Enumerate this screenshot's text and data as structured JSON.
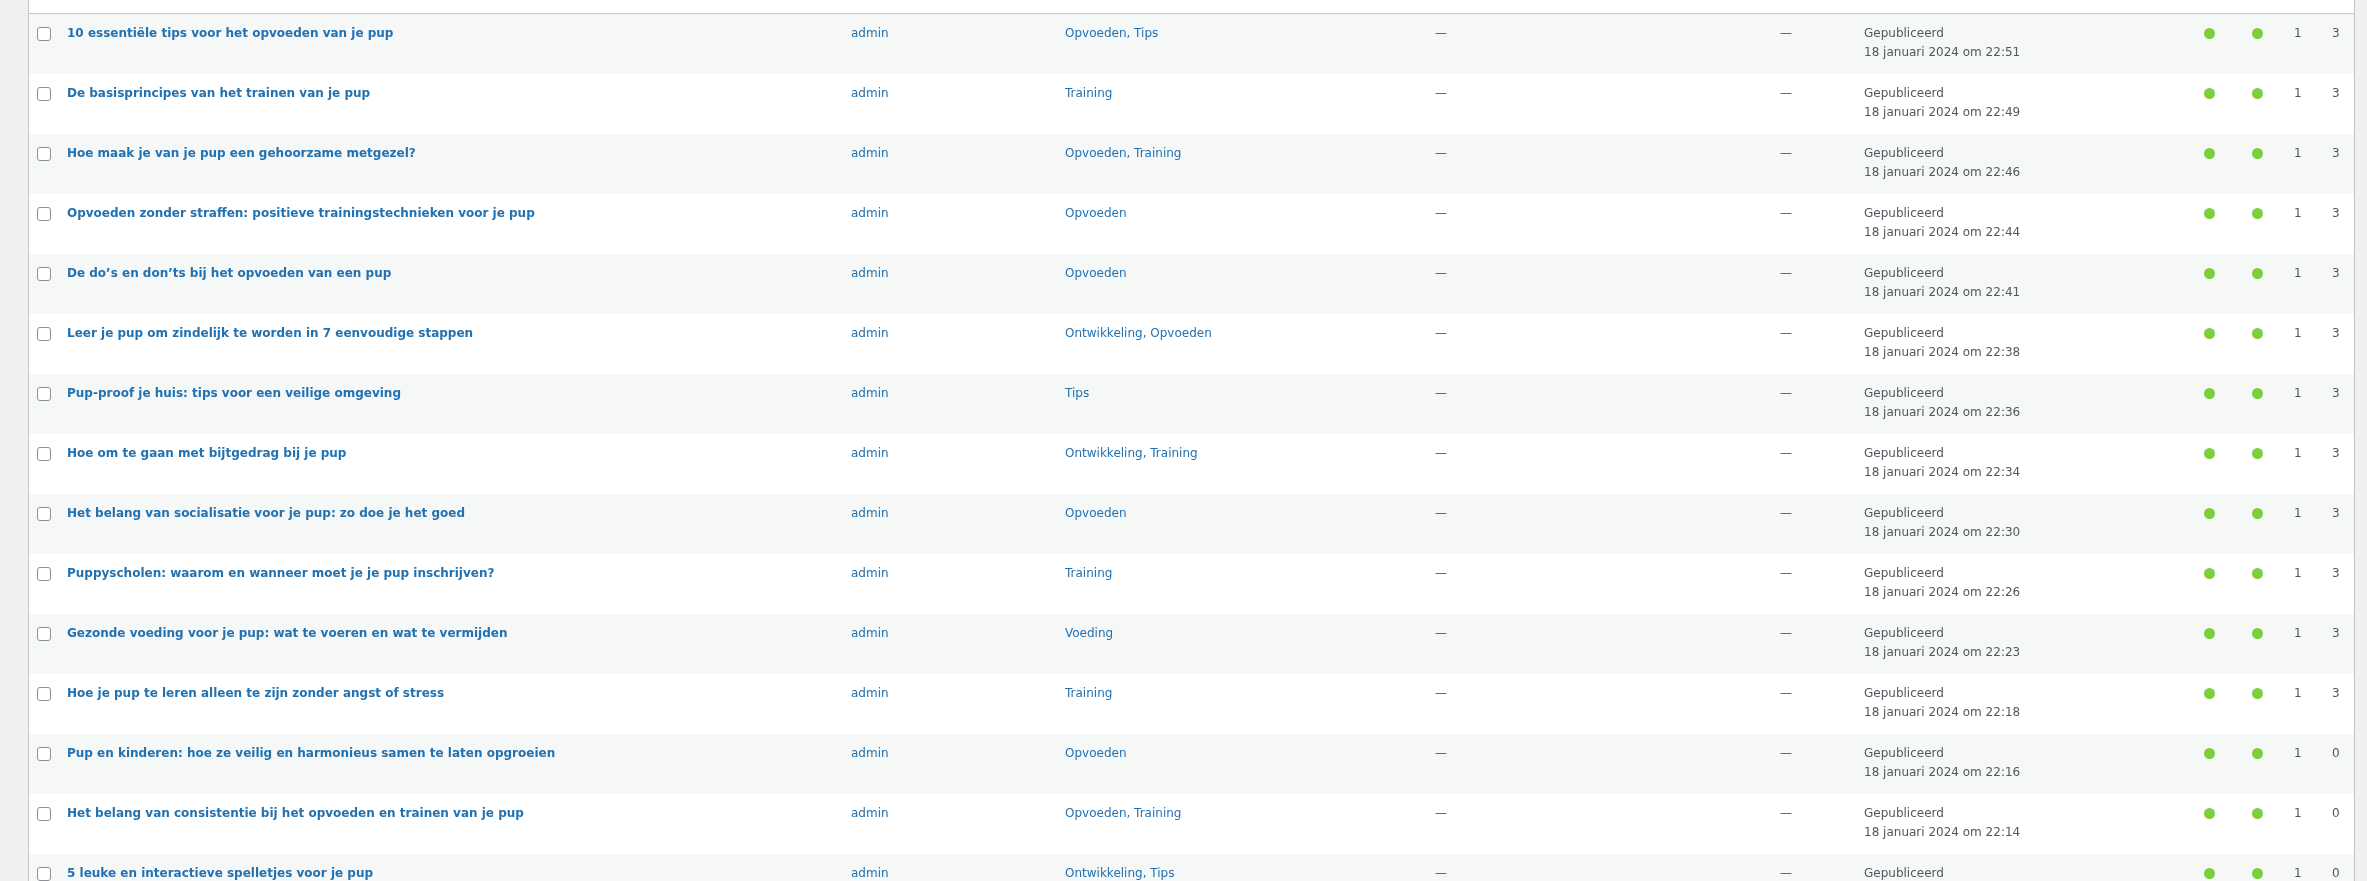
{
  "posts": [
    {
      "title": "10 essentiële tips voor het opvoeden van je pup",
      "author": "admin",
      "categories": "Opvoeden, Tips",
      "tags": "—",
      "comments": "—",
      "status": "Gepubliceerd",
      "date": "18 januari 2024 om 22:51",
      "seo": {
        "color": "#7ad03a"
      },
      "readability": {
        "color": "#7ad03a"
      },
      "column_10": "1",
      "column_11": "3",
      "checked": false
    },
    {
      "title": "De basisprincipes van het trainen van je pup",
      "author": "admin",
      "categories": "Training",
      "tags": "—",
      "comments": "—",
      "status": "Gepubliceerd",
      "date": "18 januari 2024 om 22:49",
      "seo": {
        "color": "#7ad03a"
      },
      "readability": {
        "color": "#7ad03a"
      },
      "column_10": "1",
      "column_11": "3",
      "checked": false
    },
    {
      "title": "Hoe maak je van je pup een gehoorzame metgezel?",
      "author": "admin",
      "categories": "Opvoeden, Training",
      "tags": "—",
      "comments": "—",
      "status": "Gepubliceerd",
      "date": "18 januari 2024 om 22:46",
      "seo": {
        "color": "#7ad03a"
      },
      "readability": {
        "color": "#7ad03a"
      },
      "column_10": "1",
      "column_11": "3",
      "checked": false
    },
    {
      "title": "Opvoeden zonder straffen: positieve trainingstechnieken voor je pup",
      "author": "admin",
      "categories": "Opvoeden",
      "tags": "—",
      "comments": "—",
      "status": "Gepubliceerd",
      "date": "18 januari 2024 om 22:44",
      "seo": {
        "color": "#7ad03a"
      },
      "readability": {
        "color": "#7ad03a"
      },
      "column_10": "1",
      "column_11": "3",
      "checked": false
    },
    {
      "title": "De do’s en don’ts bij het opvoeden van een pup",
      "author": "admin",
      "categories": "Opvoeden",
      "tags": "—",
      "comments": "—",
      "status": "Gepubliceerd",
      "date": "18 januari 2024 om 22:41",
      "seo": {
        "color": "#7ad03a"
      },
      "readability": {
        "color": "#7ad03a"
      },
      "column_10": "1",
      "column_11": "3",
      "checked": false
    },
    {
      "title": "Leer je pup om zindelijk te worden in 7 eenvoudige stappen",
      "author": "admin",
      "categories": "Ontwikkeling, Opvoeden",
      "tags": "—",
      "comments": "—",
      "status": "Gepubliceerd",
      "date": "18 januari 2024 om 22:38",
      "seo": {
        "color": "#7ad03a"
      },
      "readability": {
        "color": "#7ad03a"
      },
      "column_10": "1",
      "column_11": "3",
      "checked": false
    },
    {
      "title": "Pup-proof je huis: tips voor een veilige omgeving",
      "author": "admin",
      "categories": "Tips",
      "tags": "—",
      "comments": "—",
      "status": "Gepubliceerd",
      "date": "18 januari 2024 om 22:36",
      "seo": {
        "color": "#7ad03a"
      },
      "readability": {
        "color": "#7ad03a"
      },
      "column_10": "1",
      "column_11": "3",
      "checked": false
    },
    {
      "title": "Hoe om te gaan met bijtgedrag bij je pup",
      "author": "admin",
      "categories": "Ontwikkeling, Training",
      "tags": "—",
      "comments": "—",
      "status": "Gepubliceerd",
      "date": "18 januari 2024 om 22:34",
      "seo": {
        "color": "#7ad03a"
      },
      "readability": {
        "color": "#7ad03a"
      },
      "column_10": "1",
      "column_11": "3",
      "checked": false
    },
    {
      "title": "Het belang van socialisatie voor je pup: zo doe je het goed",
      "author": "admin",
      "categories": "Opvoeden",
      "tags": "—",
      "comments": "—",
      "status": "Gepubliceerd",
      "date": "18 januari 2024 om 22:30",
      "seo": {
        "color": "#7ad03a"
      },
      "readability": {
        "color": "#7ad03a"
      },
      "column_10": "1",
      "column_11": "3",
      "checked": false
    },
    {
      "title": "Puppyscholen: waarom en wanneer moet je je pup inschrijven?",
      "author": "admin",
      "categories": "Training",
      "tags": "—",
      "comments": "—",
      "status": "Gepubliceerd",
      "date": "18 januari 2024 om 22:26",
      "seo": {
        "color": "#7ad03a"
      },
      "readability": {
        "color": "#7ad03a"
      },
      "column_10": "1",
      "column_11": "3",
      "checked": false
    },
    {
      "title": "Gezonde voeding voor je pup: wat te voeren en wat te vermijden",
      "author": "admin",
      "categories": "Voeding",
      "tags": "—",
      "comments": "—",
      "status": "Gepubliceerd",
      "date": "18 januari 2024 om 22:23",
      "seo": {
        "color": "#7ad03a"
      },
      "readability": {
        "color": "#7ad03a"
      },
      "column_10": "1",
      "column_11": "3",
      "checked": false
    },
    {
      "title": "Hoe je pup te leren alleen te zijn zonder angst of stress",
      "author": "admin",
      "categories": "Training",
      "tags": "—",
      "comments": "—",
      "status": "Gepubliceerd",
      "date": "18 januari 2024 om 22:18",
      "seo": {
        "color": "#7ad03a"
      },
      "readability": {
        "color": "#7ad03a"
      },
      "column_10": "1",
      "column_11": "3",
      "checked": false
    },
    {
      "title": "Pup en kinderen: hoe ze veilig en harmonieus samen te laten opgroeien",
      "author": "admin",
      "categories": "Opvoeden",
      "tags": "—",
      "comments": "—",
      "status": "Gepubliceerd",
      "date": "18 januari 2024 om 22:16",
      "seo": {
        "color": "#7ad03a"
      },
      "readability": {
        "color": "#7ad03a"
      },
      "column_10": "1",
      "column_11": "0",
      "checked": false
    },
    {
      "title": "Het belang van consistentie bij het opvoeden en trainen van je pup",
      "author": "admin",
      "categories": "Opvoeden, Training",
      "tags": "—",
      "comments": "—",
      "status": "Gepubliceerd",
      "date": "18 januari 2024 om 22:14",
      "seo": {
        "color": "#7ad03a"
      },
      "readability": {
        "color": "#7ad03a"
      },
      "column_10": "1",
      "column_11": "0",
      "checked": false
    },
    {
      "title": "5 leuke en interactieve spelletjes voor je pup",
      "author": "admin",
      "categories": "Ontwikkeling, Tips",
      "tags": "—",
      "comments": "—",
      "status": "Gepubliceerd",
      "seo": {
        "color": "#7ad03a"
      },
      "readability": {
        "color": "#7ad03a"
      },
      "column_10": "1",
      "column_11": "0",
      "checked": false
    }
  ]
}
